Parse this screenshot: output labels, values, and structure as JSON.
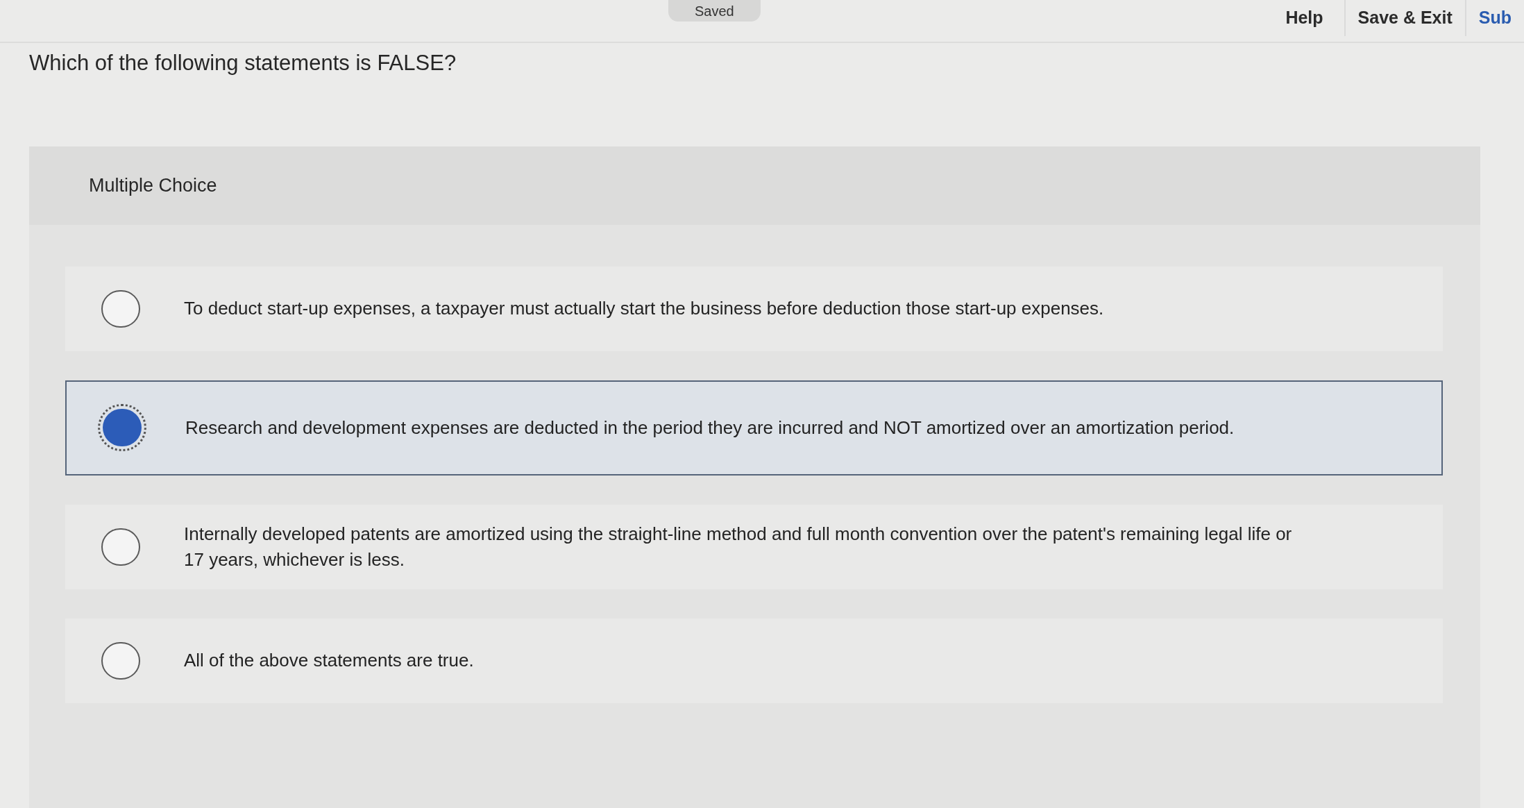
{
  "top_bar": {
    "status": "Saved",
    "links": [
      {
        "label": "Help",
        "kind": "link"
      },
      {
        "label": "Save & Exit",
        "kind": "link"
      },
      {
        "label": "Sub",
        "kind": "primary"
      }
    ]
  },
  "question": "Which of the following statements is FALSE?",
  "answer_panel": {
    "type_label": "Multiple Choice",
    "options": [
      {
        "text": "To deduct start-up expenses, a taxpayer must actually start the business before deduction those start-up expenses.",
        "selected": false
      },
      {
        "text": "Research and development expenses are deducted in the period they are incurred and NOT amortized over an amortization period.",
        "selected": true
      },
      {
        "text": "Internally developed patents are amortized using the straight-line method and full month convention over the patent's remaining legal life or 17 years, whichever is less.",
        "selected": false
      },
      {
        "text": "All of the above statements are true.",
        "selected": false
      }
    ]
  }
}
